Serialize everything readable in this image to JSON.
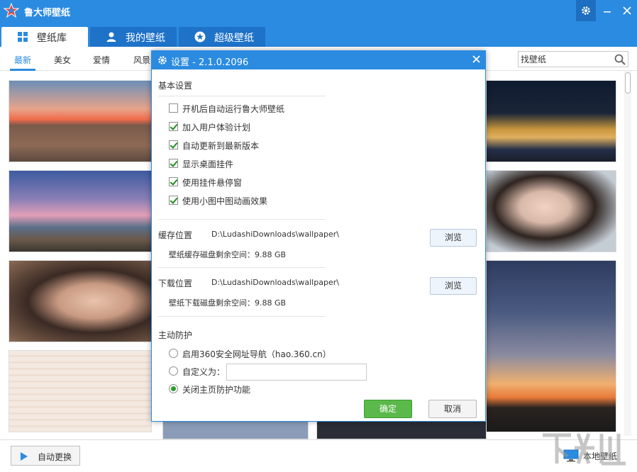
{
  "app": {
    "title": "鲁大师壁纸"
  },
  "tabs": [
    {
      "label": "壁纸库"
    },
    {
      "label": "我的壁纸"
    },
    {
      "label": "超级壁纸"
    }
  ],
  "categories": [
    "最新",
    "美女",
    "爱情",
    "风景"
  ],
  "search": {
    "value": "找壁纸"
  },
  "footer": {
    "auto_change_label": "自动更换",
    "local_wallpaper_label": "本地壁纸"
  },
  "dialog": {
    "title": "设置 - 2.1.0.2096",
    "basic_section": "基本设置",
    "options": [
      {
        "label": "开机后自动运行鲁大师壁纸",
        "checked": false
      },
      {
        "label": "加入用户体验计划",
        "checked": true
      },
      {
        "label": "自动更新到最新版本",
        "checked": true
      },
      {
        "label": "显示桌面挂件",
        "checked": true
      },
      {
        "label": "使用挂件悬停窗",
        "checked": true
      },
      {
        "label": "使用小图中图动画效果",
        "checked": true
      }
    ],
    "cache": {
      "label": "缓存位置",
      "path": "D:\\LudashiDownloads\\wallpaper\\",
      "free_space": "壁纸缓存磁盘剩余空间：9.88 GB",
      "browse_label": "浏览"
    },
    "download": {
      "label": "下载位置",
      "path": "D:\\LudashiDownloads\\wallpaper\\",
      "free_space": "壁纸下载磁盘剩余空间：9.88 GB",
      "browse_label": "浏览"
    },
    "protect_section": "主动防护",
    "protect_options": [
      {
        "label": "启用360安全网址导航（hao.360.cn）",
        "checked": false
      },
      {
        "label": "自定义为：",
        "checked": false
      },
      {
        "label": "关闭主页防护功能",
        "checked": true
      }
    ],
    "custom_value": "",
    "ok_label": "确定",
    "cancel_label": "取消"
  },
  "colors": {
    "accent": "#2b8be0",
    "ok": "#5ab94a"
  }
}
